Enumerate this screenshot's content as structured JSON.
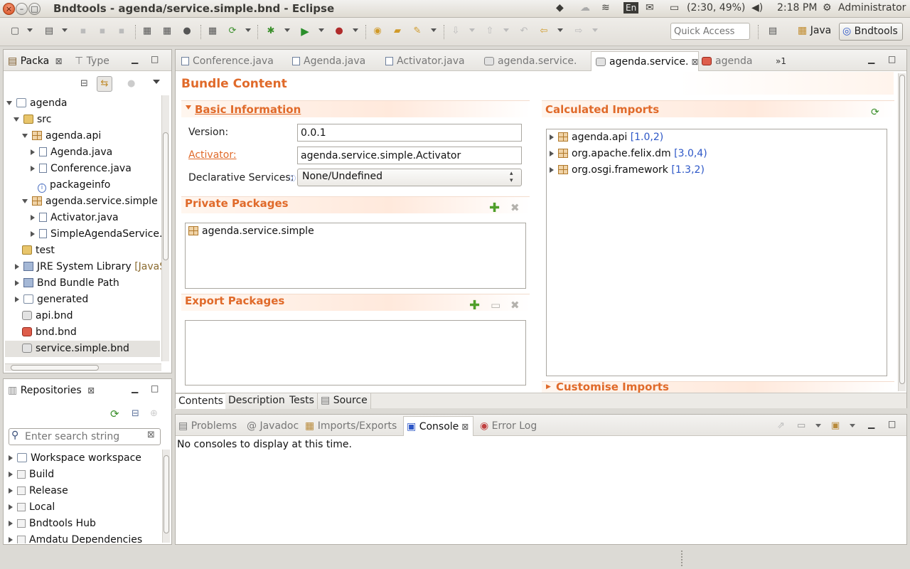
{
  "window": {
    "title": "Bndtools - agenda/service.simple.bnd - Eclipse"
  },
  "system_tray": {
    "battery": "(2:30, 49%)",
    "time": "2:18 PM",
    "user": "Administrator",
    "keyboard": "En"
  },
  "toolbar": {
    "quick_access_placeholder": "Quick Access",
    "perspectives": [
      {
        "label": "Java"
      },
      {
        "label": "Bndtools"
      }
    ]
  },
  "explorer": {
    "tabs": [
      {
        "label": "Packa"
      },
      {
        "label": "Type"
      }
    ],
    "tree": [
      {
        "label": "agenda"
      },
      {
        "label": "src"
      },
      {
        "label": "agenda.api"
      },
      {
        "label": "Agenda.java"
      },
      {
        "label": "Conference.java"
      },
      {
        "label": "packageinfo"
      },
      {
        "label": "agenda.service.simple"
      },
      {
        "label": "Activator.java"
      },
      {
        "label": "SimpleAgendaService.j"
      },
      {
        "label": "test"
      },
      {
        "label": "JRE System Library",
        "decoration": "[JavaS"
      },
      {
        "label": "Bnd Bundle Path"
      },
      {
        "label": "generated"
      },
      {
        "label": "api.bnd"
      },
      {
        "label": "bnd.bnd"
      },
      {
        "label": "service.simple.bnd"
      }
    ]
  },
  "repositories": {
    "title": "Repositories",
    "search_placeholder": "Enter search string",
    "items": [
      {
        "label": "Workspace workspace"
      },
      {
        "label": "Build"
      },
      {
        "label": "Release"
      },
      {
        "label": "Local"
      },
      {
        "label": "Bndtools Hub"
      },
      {
        "label": "Amdatu Dependencies"
      }
    ]
  },
  "editor": {
    "tabs": [
      {
        "label": "Conference.java"
      },
      {
        "label": "Agenda.java"
      },
      {
        "label": "Activator.java"
      },
      {
        "label": "agenda.service."
      },
      {
        "label": "agenda.service."
      },
      {
        "label": "agenda"
      }
    ],
    "overflow": "»1",
    "page_title": "Bundle Content",
    "basic": {
      "title": "Basic Information",
      "version_label": "Version:",
      "version_value": "0.0.1",
      "activator_label": "Activator:",
      "activator_value": "agenda.service.simple.Activator",
      "ds_label": "Declarative Services:",
      "ds_value": "None/Undefined"
    },
    "private_packages": {
      "title": "Private Packages",
      "items": [
        {
          "label": "agenda.service.simple"
        }
      ]
    },
    "export_packages": {
      "title": "Export Packages"
    },
    "calculated_imports": {
      "title": "Calculated Imports",
      "items": [
        {
          "label": "agenda.api",
          "version": "[1.0,2)"
        },
        {
          "label": "org.apache.felix.dm",
          "version": "[3.0,4)"
        },
        {
          "label": "org.osgi.framework",
          "version": "[1.3,2)"
        }
      ]
    },
    "customise_imports": {
      "title": "Customise Imports"
    },
    "bottom_tabs": [
      {
        "label": "Contents"
      },
      {
        "label": "Description"
      },
      {
        "label": "Tests"
      },
      {
        "label": "Source"
      }
    ]
  },
  "console": {
    "tabs": [
      {
        "label": "Problems"
      },
      {
        "label": "Javadoc"
      },
      {
        "label": "Imports/Exports"
      },
      {
        "label": "Console"
      },
      {
        "label": "Error Log"
      }
    ],
    "message": "No consoles to display at this time."
  },
  "colors": {
    "accent": "#e06a2a",
    "version_blue": "#2d57c7",
    "close_button": "#d84a1b"
  }
}
